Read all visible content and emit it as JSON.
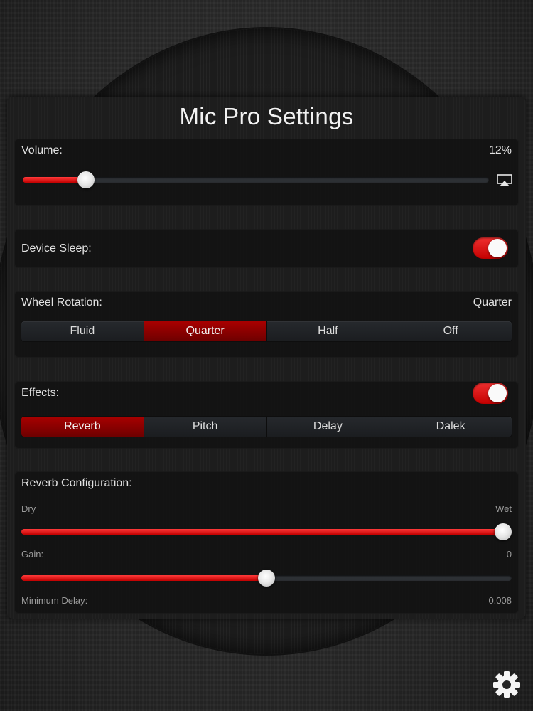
{
  "title": "Mic Pro Settings",
  "volume": {
    "label": "Volume:",
    "value_text": "12%",
    "level": 0.135
  },
  "device_sleep": {
    "label": "Device Sleep:",
    "on": true
  },
  "wheel_rotation": {
    "label": "Wheel Rotation:",
    "value_text": "Quarter",
    "options": [
      "Fluid",
      "Quarter",
      "Half",
      "Off"
    ],
    "selected": 1
  },
  "effects": {
    "label": "Effects:",
    "on": true,
    "options": [
      "Reverb",
      "Pitch",
      "Delay",
      "Dalek"
    ],
    "selected": 0
  },
  "reverb_config": {
    "label": "Reverb Configuration:",
    "dry_label": "Dry",
    "wet_label": "Wet",
    "mix_level": 1.0,
    "gain_label": "Gain:",
    "gain_value": "0",
    "gain_level": 0.5,
    "min_delay_label": "Minimum Delay:",
    "min_delay_value": "0.008"
  },
  "icons": {
    "airplay": "airplay-icon",
    "settings": "gear-icon"
  },
  "colors": {
    "accent": "#d10000",
    "track": "#2d3034"
  }
}
